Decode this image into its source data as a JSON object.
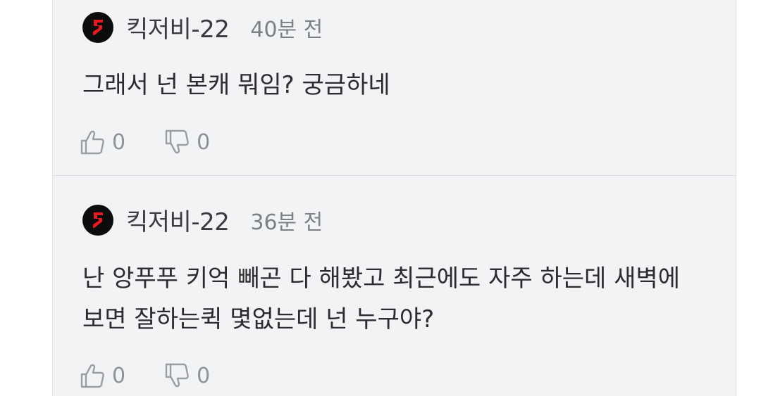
{
  "comments": [
    {
      "author": "킥저비-22",
      "time": "40분 전",
      "text": "그래서 넌 본캐 뭐임? 궁금하네",
      "likes": "0",
      "dislikes": "0"
    },
    {
      "author": "킥저비-22",
      "time": "36분 전",
      "text": "난 앙푸푸 키억 빼곤 다 해봤고 최근에도 자주 하는데 새벽에 보면 잘하는퀵 몇없는데 넌 누구야?",
      "likes": "0",
      "dislikes": "0"
    }
  ],
  "icons": {
    "avatar": "red-slash-logo-avatar",
    "like": "thumbs-up-icon",
    "dislike": "thumbs-down-icon"
  },
  "colors": {
    "panel_bg": "#f2f3f5",
    "avatar_bg": "#0c0c0c",
    "avatar_accent": "#e8191f",
    "muted_text": "#8e9196"
  }
}
